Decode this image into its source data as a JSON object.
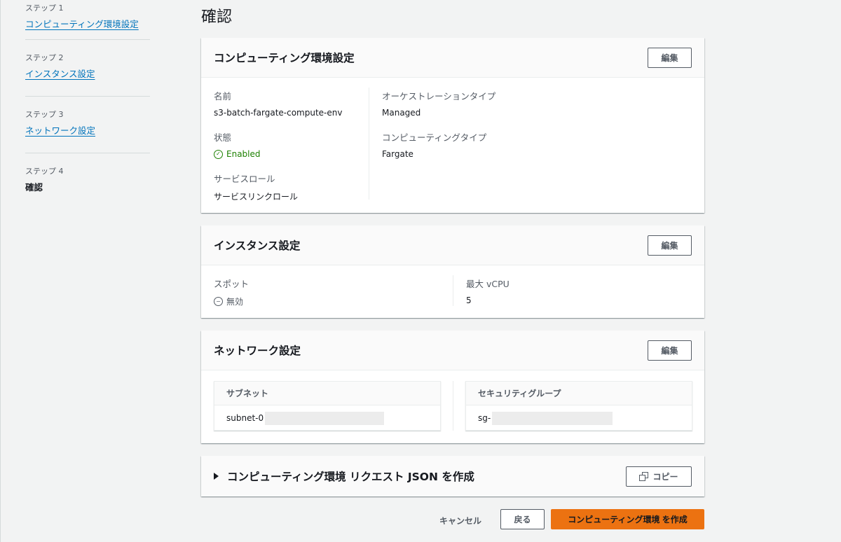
{
  "steps": [
    {
      "num": "ステップ 1",
      "label": "コンピューティング環境設定"
    },
    {
      "num": "ステップ 2",
      "label": "インスタンス設定"
    },
    {
      "num": "ステップ 3",
      "label": "ネットワーク設定"
    },
    {
      "num": "ステップ 4",
      "label": "確認"
    }
  ],
  "page_title": "確認",
  "compute_env": {
    "title": "コンピューティング環境設定",
    "edit_label": "編集",
    "name_label": "名前",
    "name_value": "s3-batch-fargate-compute-env",
    "state_label": "状態",
    "state_value": "Enabled",
    "service_role_label": "サービスロール",
    "service_role_value": "サービスリンクロール",
    "orchestration_label": "オーケストレーションタイプ",
    "orchestration_value": "Managed",
    "compute_type_label": "コンピューティングタイプ",
    "compute_type_value": "Fargate"
  },
  "instance": {
    "title": "インスタンス設定",
    "edit_label": "編集",
    "spot_label": "スポット",
    "spot_value": "無効",
    "max_vcpu_label": "最大 vCPU",
    "max_vcpu_value": "5"
  },
  "network": {
    "title": "ネットワーク設定",
    "edit_label": "編集",
    "subnet_header": "サブネット",
    "subnet_value": "subnet-0",
    "sg_header": "セキュリティグループ",
    "sg_value": "sg-"
  },
  "json_section": {
    "title": "コンピューティング環境 リクエスト JSON を作成",
    "copy_label": "コピー"
  },
  "footer": {
    "cancel_label": "キャンセル",
    "back_label": "戻る",
    "create_label": "コンピューティング環境 を作成"
  },
  "colors": {
    "accent": "#ec7211",
    "link": "#0073bb",
    "success": "#1d8102"
  }
}
